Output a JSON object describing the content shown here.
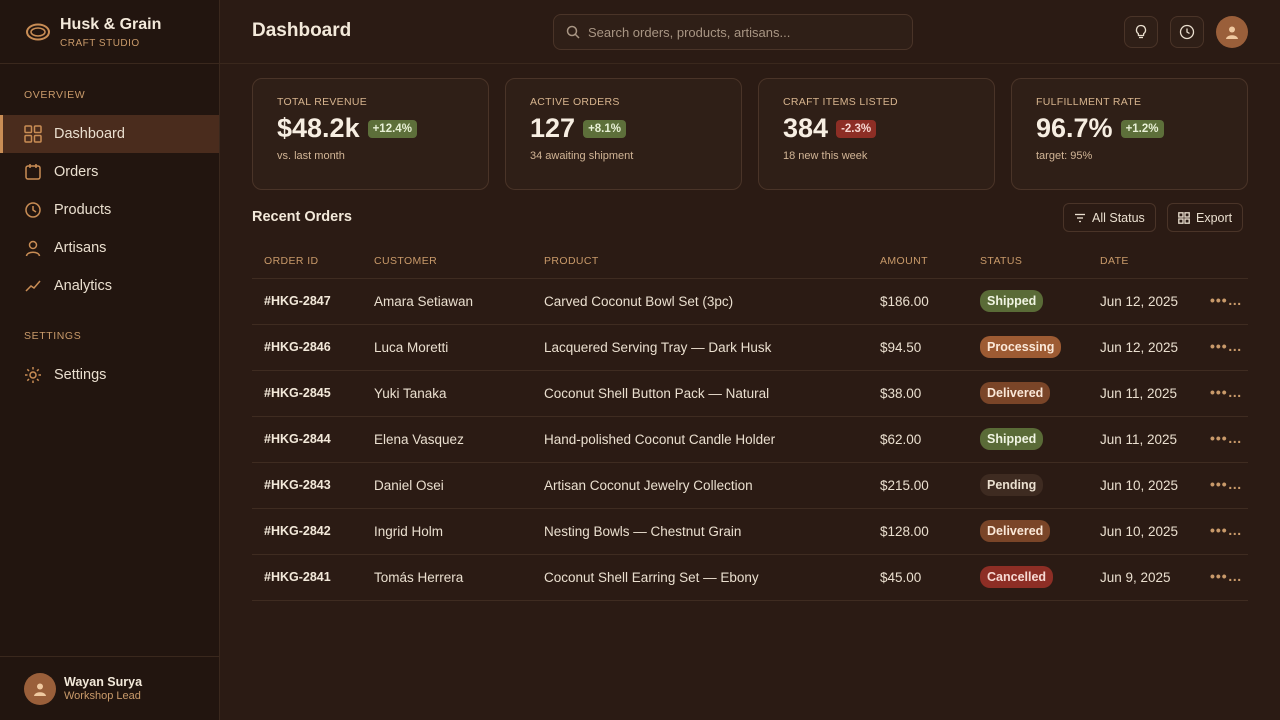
{
  "brand": {
    "name": "Husk & Grain",
    "subtitle": "CRAFT STUDIO"
  },
  "sidebar": {
    "sections": [
      {
        "title": "OVERVIEW"
      },
      {
        "title": "SETTINGS"
      }
    ],
    "items": [
      {
        "label": "Dashboard",
        "icon": "grid-icon",
        "active": true
      },
      {
        "label": "Orders",
        "icon": "calendar-icon"
      },
      {
        "label": "Products",
        "icon": "clock-icon"
      },
      {
        "label": "Artisans",
        "icon": "person-icon"
      },
      {
        "label": "Analytics",
        "icon": "trend-icon"
      },
      {
        "label": "Settings",
        "icon": "sun-gear-icon"
      }
    ],
    "user": {
      "name": "Wayan Surya",
      "role": "Workshop Lead"
    }
  },
  "header": {
    "title": "Dashboard",
    "search_placeholder": "Search orders, products, artisans..."
  },
  "stats": [
    {
      "label": "TOTAL REVENUE",
      "value": "$48.2k",
      "change": "+12.4%",
      "trend": "up",
      "note": "vs. last month"
    },
    {
      "label": "ACTIVE ORDERS",
      "value": "127",
      "change": "+8.1%",
      "trend": "up",
      "note": "34 awaiting shipment"
    },
    {
      "label": "CRAFT ITEMS LISTED",
      "value": "384",
      "change": "-2.3%",
      "trend": "down",
      "note": "18 new this week"
    },
    {
      "label": "FULFILLMENT RATE",
      "value": "96.7%",
      "change": "+1.2%",
      "trend": "up",
      "note": "target: 95%"
    }
  ],
  "orders": {
    "title": "Recent Orders",
    "filter_label": "All Status",
    "export_label": "Export",
    "columns": [
      "ORDER ID",
      "CUSTOMER",
      "PRODUCT",
      "AMOUNT",
      "STATUS",
      "DATE"
    ],
    "rows": [
      {
        "id": "#HKG-2847",
        "customer": "Amara Setiawan",
        "product": "Carved Coconut Bowl Set (3pc)",
        "amount": "$186.00",
        "status": "Shipped",
        "date": "Jun 12, 2025"
      },
      {
        "id": "#HKG-2846",
        "customer": "Luca Moretti",
        "product": "Lacquered Serving Tray — Dark Husk",
        "amount": "$94.50",
        "status": "Processing",
        "date": "Jun 12, 2025"
      },
      {
        "id": "#HKG-2845",
        "customer": "Yuki Tanaka",
        "product": "Coconut Shell Button Pack — Natural",
        "amount": "$38.00",
        "status": "Delivered",
        "date": "Jun 11, 2025"
      },
      {
        "id": "#HKG-2844",
        "customer": "Elena Vasquez",
        "product": "Hand-polished Coconut Candle Holder",
        "amount": "$62.00",
        "status": "Shipped",
        "date": "Jun 11, 2025"
      },
      {
        "id": "#HKG-2843",
        "customer": "Daniel Osei",
        "product": "Artisan Coconut Jewelry Collection",
        "amount": "$215.00",
        "status": "Pending",
        "date": "Jun 10, 2025"
      },
      {
        "id": "#HKG-2842",
        "customer": "Ingrid Holm",
        "product": "Nesting Bowls — Chestnut Grain",
        "amount": "$128.00",
        "status": "Delivered",
        "date": "Jun 10, 2025"
      },
      {
        "id": "#HKG-2841",
        "customer": "Tomás Herrera",
        "product": "Coconut Shell Earring Set — Ebony",
        "amount": "$45.00",
        "status": "Cancelled",
        "date": "Jun 9, 2025"
      }
    ],
    "row_action": "•••…"
  },
  "colors": {
    "background": "#2b1b14",
    "sidebar": "#22150f",
    "accent": "#c98d55",
    "positive": "#5d6f3a",
    "negative": "#8d2e25"
  }
}
